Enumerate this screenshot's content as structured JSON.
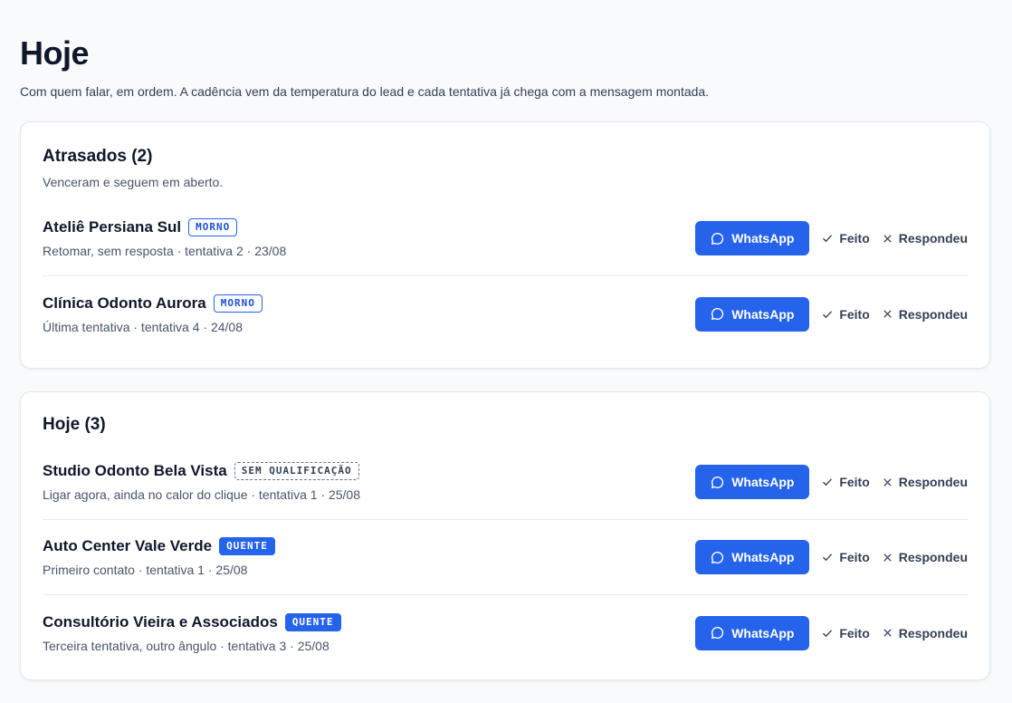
{
  "header": {
    "title": "Hoje",
    "subtitle": "Com quem falar, em ordem. A cadência vem da temperatura do lead e cada tentativa já chega com a mensagem montada."
  },
  "atrasados": {
    "title": "Atrasados (2)",
    "description": "Venceram e seguem em aberto.",
    "leads": [
      {
        "name": "Ateliê Persiana Sul",
        "tag": "MORNO",
        "meta": "Retomar, sem resposta · tentativa 2 · 23/08"
      },
      {
        "name": "Clínica Odonto Aurora",
        "tag": "MORNO",
        "meta": "Última tentativa · tentativa 4 · 24/08"
      }
    ]
  },
  "hoje": {
    "title": "Hoje (3)",
    "leads": [
      {
        "name": "Studio Odonto Bela Vista",
        "tag": "SEM QUALIFICAÇÃO",
        "meta": "Ligar agora, ainda no calor do clique · tentativa 1 · 25/08"
      },
      {
        "name": "Auto Center Vale Verde",
        "tag": "QUENTE",
        "meta": "Primeiro contato · tentativa 1 · 25/08"
      },
      {
        "name": "Consultório Vieira e Associados",
        "tag": "QUENTE",
        "meta": "Terceira tentativa, outro ângulo · tentativa 3 · 25/08"
      }
    ]
  },
  "actions": {
    "whatsapp_label": "WhatsApp",
    "done_label": "Feito",
    "replied_label": "Respondeu"
  },
  "icons": {
    "whatsapp": "chat-bubble-icon",
    "done": "check-icon",
    "replied": "x-icon"
  },
  "colors": {
    "accent": "#2563eb",
    "tag_morno": "#2563eb",
    "tag_quente": "#2563eb",
    "tag_sem": "#64748b"
  }
}
